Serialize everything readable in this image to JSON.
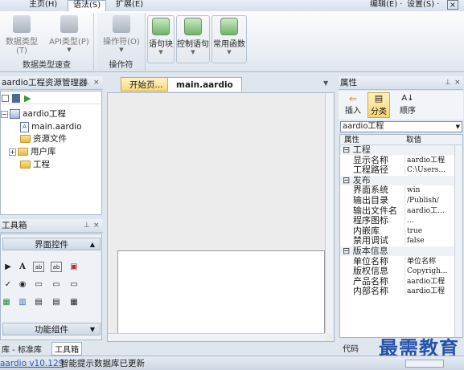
{
  "ribbon_tabs": [
    "主页(H)",
    "语法(S)",
    "扩展(E)"
  ],
  "ribbon_right": {
    "edit": "编辑(E) ·",
    "settings": "设置(S) ·",
    "close": "×"
  },
  "groups": {
    "datatype": {
      "label": "数据类型速查",
      "btn1": "数据类型(T)",
      "btn2": "API类型(P)"
    },
    "operators": {
      "label": "操作符",
      "btn": "操作符(O)"
    },
    "code": {
      "btn1": "语句块",
      "btn2": "控制语句",
      "btn3": "常用函数"
    }
  },
  "project_panel": {
    "title": "aardio工程资源管理器",
    "tree": [
      "aardio工程",
      "main.aardio",
      "资源文件",
      "用户库",
      "工程"
    ]
  },
  "toolbox": {
    "title": "工具箱",
    "section1": "界面控件",
    "section2": "功能组件",
    "bottom_tabs": [
      "库 - 标准库",
      "工具箱"
    ],
    "icons": [
      "▶",
      "A",
      "ab",
      "ab",
      "▣",
      "✓",
      "◉",
      "▭",
      "▭",
      "▭",
      "▦",
      "▥",
      "▤",
      "▤",
      "▦"
    ]
  },
  "editor": {
    "tab_start": "开始页...",
    "tab_main": "main.aardio"
  },
  "properties": {
    "title": "属性",
    "toolbar": [
      "插入",
      "分类",
      "顺序"
    ],
    "selector": "aardio工程",
    "col_name": "属性",
    "col_value": "取值",
    "rows": [
      {
        "cat": true,
        "name": "工程"
      },
      {
        "name": "显示名称",
        "value": "aardio工程"
      },
      {
        "name": "工程路径",
        "value": "C:\\Users..."
      },
      {
        "cat": true,
        "name": "发布"
      },
      {
        "name": "界面系统",
        "value": "win"
      },
      {
        "name": "输出目录",
        "value": "/Publish/"
      },
      {
        "name": "输出文件名",
        "value": "aardio工..."
      },
      {
        "name": "程序图标",
        "value": "..."
      },
      {
        "name": "内嵌库",
        "value": "true"
      },
      {
        "name": "禁用调试",
        "value": "false"
      },
      {
        "cat": true,
        "name": "版本信息"
      },
      {
        "name": "单位名称",
        "value": "单位名称"
      },
      {
        "name": "版权信息",
        "value": "Copyrigh..."
      },
      {
        "name": "产品名称",
        "value": "aardio工程"
      },
      {
        "name": "内部名称",
        "value": "aardio工程"
      }
    ],
    "bottom_tab": "代码"
  },
  "status": {
    "version": "aardio v10.129",
    "message": "智能提示数据库已更新"
  },
  "watermark": "最需教育"
}
